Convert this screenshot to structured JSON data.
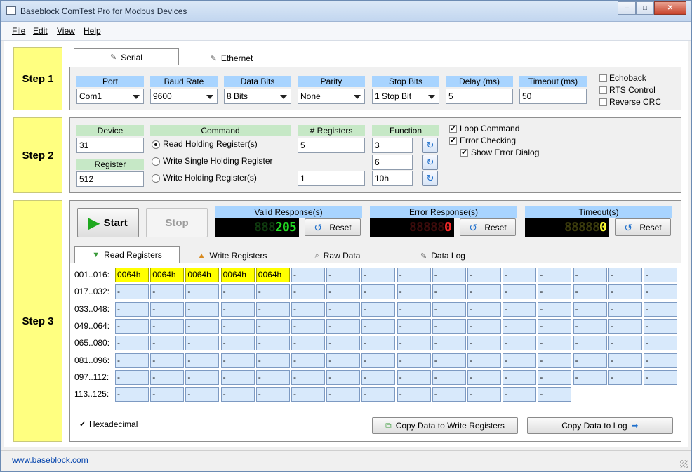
{
  "window": {
    "title": "Baseblock ComTest Pro for Modbus Devices",
    "caption_buttons": [
      "–",
      "□",
      "✕"
    ]
  },
  "menu": [
    "File",
    "Edit",
    "View",
    "Help"
  ],
  "steps": [
    "Step 1",
    "Step 2",
    "Step 3"
  ],
  "step1": {
    "tabs": [
      "Serial",
      "Ethernet"
    ],
    "fields": [
      {
        "label": "Port",
        "value": "Com1",
        "type": "select"
      },
      {
        "label": "Baud Rate",
        "value": "9600",
        "type": "select"
      },
      {
        "label": "Data Bits",
        "value": "8 Bits",
        "type": "select"
      },
      {
        "label": "Parity",
        "value": "None",
        "type": "select"
      },
      {
        "label": "Stop Bits",
        "value": "1 Stop Bit",
        "type": "select"
      },
      {
        "label": "Delay (ms)",
        "value": "5",
        "type": "input"
      },
      {
        "label": "Timeout (ms)",
        "value": "50",
        "type": "input"
      }
    ],
    "options": [
      {
        "label": "Echoback",
        "checked": false
      },
      {
        "label": "RTS Control",
        "checked": false
      },
      {
        "label": "Reverse CRC",
        "checked": false
      }
    ]
  },
  "step2": {
    "device_label": "Device",
    "device_value": "31",
    "register_label": "Register",
    "register_value": "512",
    "command_label": "Command",
    "commands": [
      {
        "label": "Read Holding Register(s)",
        "selected": true
      },
      {
        "label": "Write Single Holding Register",
        "selected": false
      },
      {
        "label": "Write Holding Register(s)",
        "selected": false
      }
    ],
    "registers_label": "# Registers",
    "registers_values": [
      "5",
      "1"
    ],
    "function_label": "Function",
    "function_values": [
      "3",
      "6",
      "10h"
    ],
    "options": [
      {
        "label": "Loop Command",
        "checked": true
      },
      {
        "label": "Error Checking",
        "checked": true
      },
      {
        "label": "Show Error Dialog",
        "checked": true
      }
    ]
  },
  "step3": {
    "start_label": "Start",
    "stop_label": "Stop",
    "counters": [
      {
        "label": "Valid Response(s)",
        "digits": "888205",
        "color": "#22dd22",
        "dim": "#0f3a0f",
        "active_from": 3
      },
      {
        "label": "Error Response(s)",
        "digits": "888880",
        "color": "#ff2a2a",
        "dim": "#3c0b0b",
        "active_from": 5
      },
      {
        "label": "Timeout(s)",
        "digits": "888880",
        "color": "#ffff33",
        "dim": "#3a3a0c",
        "active_from": 5
      }
    ],
    "reset_label": "Reset",
    "tabs": [
      "Read Registers",
      "Write Registers",
      "Raw Data",
      "Data Log"
    ],
    "row_labels": [
      "001..016:",
      "017..032:",
      "033..048:",
      "049..064:",
      "065..080:",
      "081..096:",
      "097..112:",
      "113..125:"
    ],
    "cells": [
      [
        "0064h",
        "0064h",
        "0064h",
        "0064h",
        "0064h",
        "-",
        "-",
        "-",
        "-",
        "-",
        "-",
        "-",
        "-",
        "-",
        "-",
        "-"
      ],
      [
        "-",
        "-",
        "-",
        "-",
        "-",
        "-",
        "-",
        "-",
        "-",
        "-",
        "-",
        "-",
        "-",
        "-",
        "-",
        "-"
      ],
      [
        "-",
        "-",
        "-",
        "-",
        "-",
        "-",
        "-",
        "-",
        "-",
        "-",
        "-",
        "-",
        "-",
        "-",
        "-",
        "-"
      ],
      [
        "-",
        "-",
        "-",
        "-",
        "-",
        "-",
        "-",
        "-",
        "-",
        "-",
        "-",
        "-",
        "-",
        "-",
        "-",
        "-"
      ],
      [
        "-",
        "-",
        "-",
        "-",
        "-",
        "-",
        "-",
        "-",
        "-",
        "-",
        "-",
        "-",
        "-",
        "-",
        "-",
        "-"
      ],
      [
        "-",
        "-",
        "-",
        "-",
        "-",
        "-",
        "-",
        "-",
        "-",
        "-",
        "-",
        "-",
        "-",
        "-",
        "-",
        "-"
      ],
      [
        "-",
        "-",
        "-",
        "-",
        "-",
        "-",
        "-",
        "-",
        "-",
        "-",
        "-",
        "-",
        "-",
        "-",
        "-",
        "-"
      ],
      [
        "-",
        "-",
        "-",
        "-",
        "-",
        "-",
        "-",
        "-",
        "-",
        "-",
        "-",
        "-",
        "-"
      ]
    ],
    "highlight_color": "#ffff00",
    "hexadecimal_label": "Hexadecimal",
    "hexadecimal_checked": true,
    "copy_write_label": "Copy Data to Write Registers",
    "copy_log_label": "Copy Data to Log"
  },
  "status": {
    "link": "www.baseblock.com"
  },
  "icons": {
    "tab_serial": "serial-plug-icon",
    "tab_ethernet": "ethernet-plug-icon",
    "start": "play-icon",
    "reset": "reset-icon",
    "refresh": "refresh-icon",
    "read_tab": "read-registers-icon",
    "write_tab": "write-registers-icon",
    "raw_tab": "raw-data-icon",
    "log_tab": "data-log-icon",
    "copy_write": "copy-icon",
    "copy_log": "arrow-right-icon"
  }
}
